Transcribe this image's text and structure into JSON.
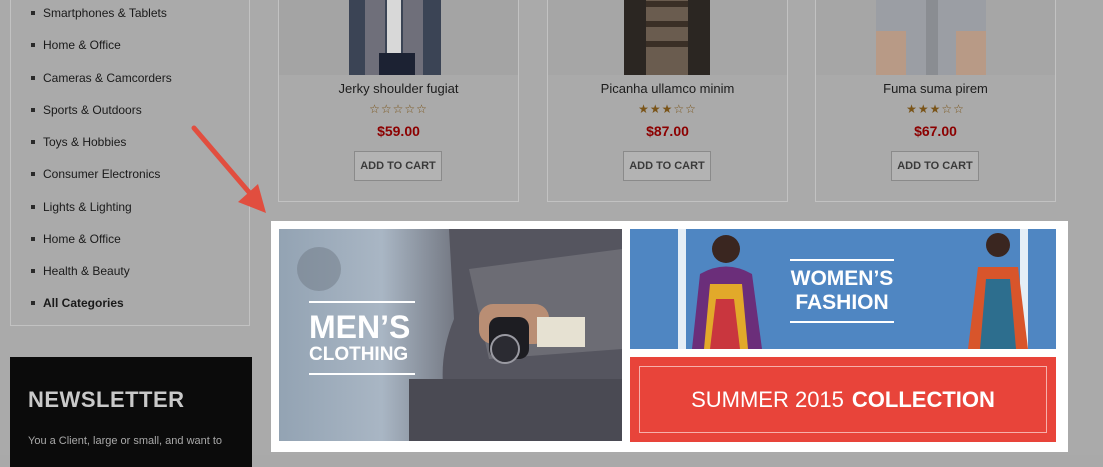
{
  "sidebar": {
    "categories": [
      "Smartphones & Tablets",
      "Home & Office",
      "Cameras & Camcorders",
      "Sports & Outdoors",
      "Toys & Hobbies",
      "Consumer Electronics",
      "Lights & Lighting",
      "Home & Office",
      "Health & Beauty",
      "All Categories"
    ]
  },
  "newsletter": {
    "title": "NEWSLETTER",
    "text": "You a Client, large or small, and want to"
  },
  "products": [
    {
      "name": "Jerky shoulder fugiat",
      "rating": 0,
      "stars": "☆☆☆☆☆",
      "price": "$59.00",
      "cart_label": "ADD TO CART"
    },
    {
      "name": "Picanha ullamco minim",
      "rating": 3,
      "stars": "★★★☆☆",
      "price": "$87.00",
      "cart_label": "ADD TO CART"
    },
    {
      "name": "Fuma suma pirem",
      "rating": 3,
      "stars": "★★★☆☆",
      "price": "$67.00",
      "cart_label": "ADD TO CART"
    }
  ],
  "banners": {
    "men": {
      "line1": "MEN’S",
      "line2": "CLOTHING"
    },
    "women": {
      "line1": "WOMEN’S",
      "line2": "FASHION"
    },
    "summer": {
      "light": "SUMMER 2015",
      "bold": "COLLECTION"
    }
  },
  "colors": {
    "accent_red": "#e8443a",
    "price_red": "#8c0000",
    "arrow": "#e14e3f"
  }
}
